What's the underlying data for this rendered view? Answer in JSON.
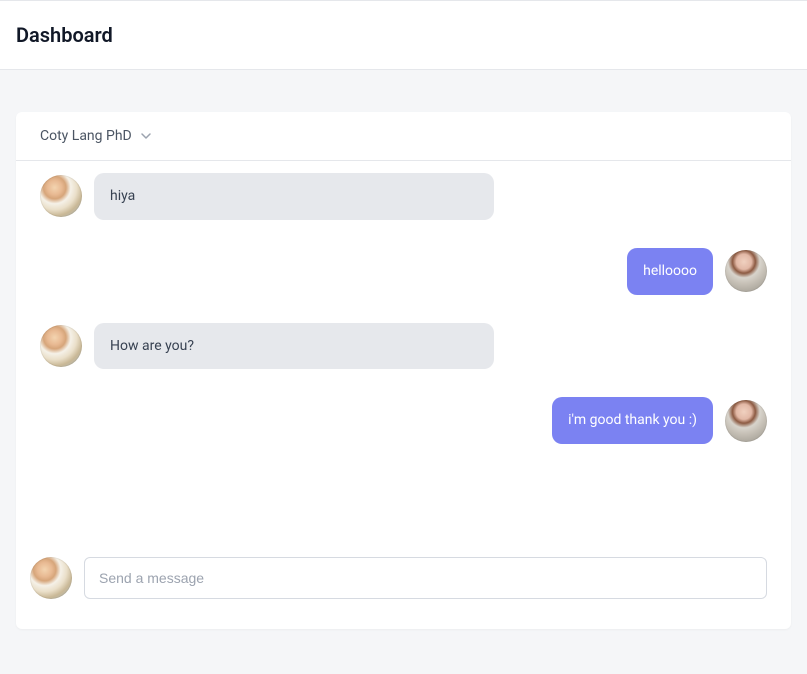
{
  "header": {
    "title": "Dashboard"
  },
  "chat": {
    "contact_name": "Coty Lang PhD",
    "messages": [
      {
        "direction": "incoming",
        "text": "hiya"
      },
      {
        "direction": "outgoing",
        "text": "helloooo"
      },
      {
        "direction": "incoming",
        "text": "How are you?"
      },
      {
        "direction": "outgoing",
        "text": "i'm good thank you :)"
      }
    ],
    "composer": {
      "placeholder": "Send a message"
    }
  }
}
